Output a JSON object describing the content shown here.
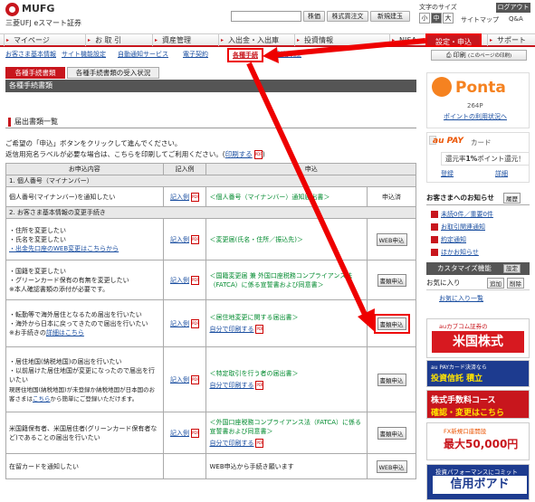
{
  "header": {
    "brand": "MUFG",
    "subbrand": "三菱UFJ eスマート証券",
    "buttons": [
      "株価",
      "株式買注文",
      "新規建玉"
    ],
    "fontsize_label": "文字のサイズ",
    "fontsize": [
      "小",
      "中",
      "大"
    ],
    "logout": "ログアウト",
    "links": [
      "サイトマップ",
      "Q&A"
    ]
  },
  "nav": {
    "items": [
      "マイページ",
      "お 取 引",
      "資産管理",
      "入出金・入出庫",
      "投資情報",
      "NISA",
      "設定・申込",
      "サポート"
    ]
  },
  "subnav": {
    "items": [
      "お客さま基本情報",
      "サイト機能設定",
      "自動通知サービス",
      "電子契約",
      "各種手続",
      "ご利用制度"
    ]
  },
  "tabs": [
    "各種手続書類",
    "各種手続書類の受入状況"
  ],
  "page_title": "各種手続書類",
  "section_heading": "届出書類一覧",
  "intro": {
    "line1": "ご希望の「申込」ボタンをクリックして進んでください。",
    "line2_prefix": "返信用宛名ラベルが必要な場合は、こちらを印刷してご利用ください。(",
    "print_link": "印刷する",
    "line2_suffix": ")"
  },
  "table": {
    "headers": [
      "お申込内容",
      "記入例",
      "申込"
    ],
    "group1": "1. 個人番号（マイナンバー）",
    "row1": {
      "content": "個人番号(マイナンバー)を通知したい",
      "example": "記入例",
      "doc": "＜個人番号（マイナンバー）通知届出書＞",
      "apply": "申込済"
    },
    "group2": "2. お客さま基本情報の変更手続き",
    "row2": {
      "lines": [
        "・住所を変更したい",
        "・氏名を変更したい"
      ],
      "link": "・出金先口座のWEB変更はこちらから",
      "example": "記入例",
      "doc": "＜変更届(氏名・住所／振込先)＞",
      "apply": "WEB申込"
    },
    "row3": {
      "lines": [
        "・国籍を変更したい",
        "・グリーンカード保有の有無を変更したい",
        "※本人確認書類の添付が必要です。"
      ],
      "example": "記入例",
      "doc": "＜国籍変更届 兼 外国口座税務コンプライアンス法（FATCA）に係る宣誓書および同意書＞",
      "apply": "書類申込"
    },
    "row4": {
      "lines": [
        "・転勤等で海外居住となるため届出を行いたい",
        "・海外から日本に戻ってきたので届出を行いたい"
      ],
      "note_prefix": "※お手続きの",
      "note_link": "詳細はこちら",
      "example": "記入例",
      "doc": "＜居住地変更に関する届出書＞",
      "print": "自分で印刷する",
      "apply": "書類申込"
    },
    "row5": {
      "lines": [
        "・居住地国(納税地国)の届出を行いたい",
        "・以前届けた居住地国が変更になったので届出を行いたい",
        "現居住地国(納税地国)が未登録か納税地国が日本国のお客さまは"
      ],
      "link": "こちら",
      "suffix": "から簡単にご登録いただけます。",
      "example": "記入例",
      "doc": "＜特定取引を行う者の届出書＞",
      "print": "自分で印刷する",
      "apply": "書類申込"
    },
    "row6": {
      "lines": [
        "米国籍保有者、米国居住者(グリーンカード保有者など)であることの届出を行いたい"
      ],
      "example": "記入例",
      "doc": "＜外国口座税務コンプライアンス法（FATCA）に係る宣誓書および同意書＞",
      "print": "自分で印刷する",
      "apply": "書類申込"
    },
    "row7": {
      "content": "在留カードを通知したい",
      "doc": "WEB申込から手続き願います",
      "apply": "WEB申込"
    }
  },
  "sidebar": {
    "print": "印刷",
    "print_note": "(このページの印刷)",
    "ponta": {
      "logo": "Ponta",
      "points": "264P",
      "link": "ポイントの利用状況へ"
    },
    "aupay": {
      "logo": "au PAY",
      "card": "カード",
      "points_prefix": "還元率",
      "points_value": "1%",
      "points_suffix": "ポイント還元！",
      "register": "登録",
      "detail": "詳細"
    },
    "notice": {
      "title": "お客さまへのお知らせ",
      "history": "履歴",
      "items": [
        "未読0件／重要0件",
        "お取引関連通知",
        "約定通知",
        "ほかお知らせ"
      ]
    },
    "custom": {
      "title": "カスタマイズ機能",
      "settings": "設定"
    },
    "favorites": {
      "title": "お気に入り",
      "add": "追加",
      "delete": "削除",
      "none": "お気に入り一覧"
    },
    "ads": {
      "ad1_sub": "auカブコム証券の",
      "ad1_main": "米国株式",
      "ad2_t1": "au PAYカード決済なら",
      "ad2_t2": "投資信託 積立",
      "ad3_t1": "株式手数料コース",
      "ad3_t2": "確認・変更はこちら",
      "ad4_t1": "FX新規口座開設",
      "ad4_t2": "最大50,000円",
      "ad5_t1": "投資パフォーマンスにコミット",
      "ad5_t2": "信用ボアド"
    }
  }
}
